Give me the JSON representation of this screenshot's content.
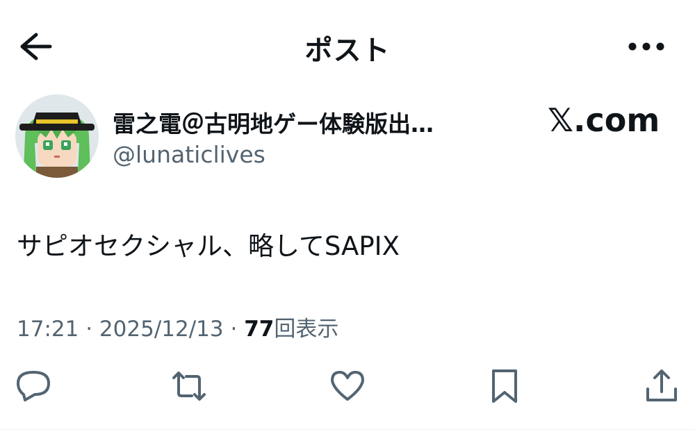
{
  "header": {
    "title": "ポスト",
    "back_icon": "arrow-left-icon",
    "more_icon": "more-horizontal-icon"
  },
  "author": {
    "display_name": "雷之電＠古明地ゲー体験版出…",
    "handle": "@lunaticlives",
    "avatar_icon": "avatar-image"
  },
  "source_badge": "𝕏.com",
  "post": {
    "text": "サピオセクシャル、略してSAPIX"
  },
  "meta": {
    "time": "17:21",
    "separator": "·",
    "date": "2025/12/13",
    "views_count": "77",
    "views_label": "回表示"
  },
  "actions": {
    "reply_icon": "reply-icon",
    "repost_icon": "repost-icon",
    "like_icon": "heart-icon",
    "bookmark_icon": "bookmark-icon",
    "share_icon": "share-icon"
  },
  "colors": {
    "text_primary": "#0f1419",
    "text_secondary": "#536471",
    "icon_gray": "#536471",
    "background": "#ffffff"
  }
}
